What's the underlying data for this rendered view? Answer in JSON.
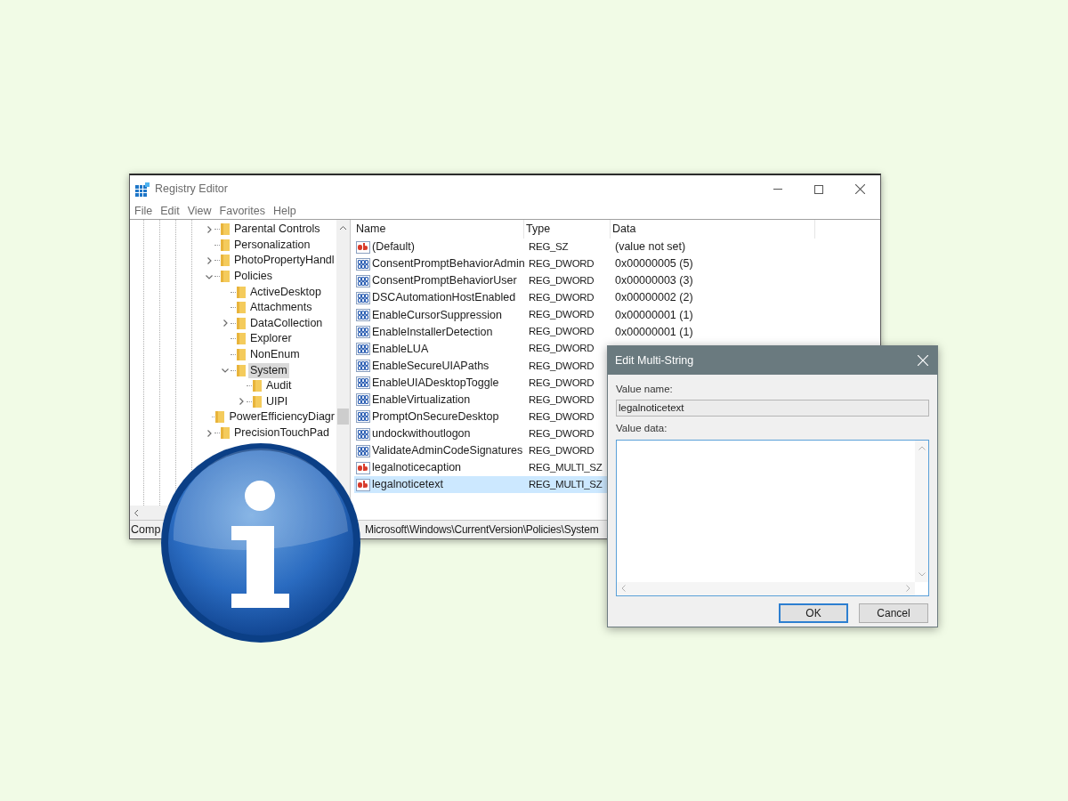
{
  "window": {
    "title": "Registry Editor"
  },
  "menu": [
    "File",
    "Edit",
    "View",
    "Favorites",
    "Help"
  ],
  "tree": [
    {
      "label": "Parental Controls",
      "expanded": false
    },
    {
      "label": "Personalization"
    },
    {
      "label": "PhotoPropertyHandl",
      "expanded": false
    },
    {
      "label": "Policies",
      "expanded": true,
      "children": [
        {
          "label": "ActiveDesktop"
        },
        {
          "label": "Attachments"
        },
        {
          "label": "DataCollection",
          "expanded": false
        },
        {
          "label": "Explorer"
        },
        {
          "label": "NonEnum"
        },
        {
          "label": "System",
          "expanded": true,
          "selected": true,
          "children": [
            {
              "label": "Audit"
            },
            {
              "label": "UIPI",
              "expanded": false
            }
          ]
        }
      ]
    },
    {
      "label": "PowerEfficiencyDiagr"
    },
    {
      "label": "PrecisionTouchPad",
      "expanded": false
    }
  ],
  "table": {
    "columns": [
      "Name",
      "Type",
      "Data"
    ],
    "rows": [
      {
        "kind": "string",
        "name": "(Default)",
        "type": "REG_SZ",
        "data": "(value not set)",
        "selected": false
      },
      {
        "kind": "dword",
        "name": "ConsentPromptBehaviorAdmin",
        "type": "REG_DWORD",
        "data": "0x00000005 (5)",
        "selected": false
      },
      {
        "kind": "dword",
        "name": "ConsentPromptBehaviorUser",
        "type": "REG_DWORD",
        "data": "0x00000003 (3)",
        "selected": false
      },
      {
        "kind": "dword",
        "name": "DSCAutomationHostEnabled",
        "type": "REG_DWORD",
        "data": "0x00000002 (2)",
        "selected": false
      },
      {
        "kind": "dword",
        "name": "EnableCursorSuppression",
        "type": "REG_DWORD",
        "data": "0x00000001 (1)",
        "selected": false
      },
      {
        "kind": "dword",
        "name": "EnableInstallerDetection",
        "type": "REG_DWORD",
        "data": "0x00000001 (1)",
        "selected": false
      },
      {
        "kind": "dword",
        "name": "EnableLUA",
        "type": "REG_DWORD",
        "selected": false
      },
      {
        "kind": "dword",
        "name": "EnableSecureUIAPaths",
        "type": "REG_DWORD",
        "selected": false
      },
      {
        "kind": "dword",
        "name": "EnableUIADesktopToggle",
        "type": "REG_DWORD",
        "selected": false
      },
      {
        "kind": "dword",
        "name": "EnableVirtualization",
        "type": "REG_DWORD",
        "selected": false
      },
      {
        "kind": "dword",
        "name": "PromptOnSecureDesktop",
        "type": "REG_DWORD",
        "selected": false
      },
      {
        "kind": "dword",
        "name": "undockwithoutlogon",
        "type": "REG_DWORD",
        "selected": false
      },
      {
        "kind": "dword",
        "name": "ValidateAdminCodeSignatures",
        "type": "REG_DWORD",
        "selected": false
      },
      {
        "kind": "string",
        "name": "legalnoticecaption",
        "type": "REG_MULTI_SZ",
        "selected": false
      },
      {
        "kind": "string",
        "name": "legalnoticetext",
        "type": "REG_MULTI_SZ",
        "selected": true
      }
    ]
  },
  "status_bar": [
    "Comp",
    "Microsoft\\Windows\\CurrentVersion\\Policies\\System"
  ],
  "dialog": {
    "title": "Edit Multi-String",
    "value_name_label": "Value name:",
    "value_name": "legalnoticetext",
    "value_data_label": "Value data:",
    "buttons": [
      "OK",
      "Cancel"
    ]
  }
}
